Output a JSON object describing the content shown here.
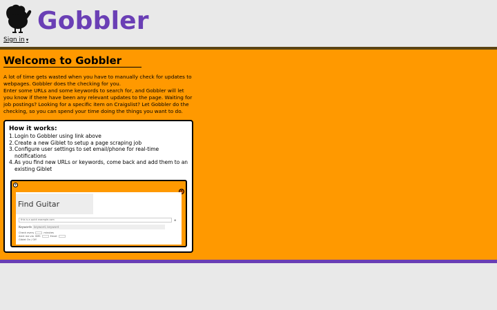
{
  "header": {
    "brand": "Gobbler",
    "signin_label": "Sign in",
    "signin_caret": "▾"
  },
  "main": {
    "welcome_title": "Welcome to Gobbler",
    "intro_lines": [
      "A lot of time gets wasted when you have to manually check for updates to",
      "webpages. Gobbler does the checking for you.",
      "Enter some URLs and some keywords to search for, and Gobbler will let",
      "you know if there have been any relevant updates to the page. Waiting for",
      "job postings? Looking for a specific item on Craigslist? Let Gobbler do the",
      "checking, so you can spend your time doing the things you want to do."
    ]
  },
  "how_it_works": {
    "title": "How it works:",
    "steps": [
      "Login to Gobbler using link above",
      "Create a new Giblet to setup a page scraping job",
      "Configure user settings to set email/phone for real-time notifications",
      "As you find new URLs or keywords, come back and add them to an existing Giblet"
    ]
  },
  "preview": {
    "plus_icon": "+",
    "close_icon": "×",
    "giblet_name": "Find Guitar",
    "url_value": "this is a quick example.com",
    "url_button": "⊕",
    "keywords_label": "Keywords",
    "keywords_value": "keyword, keyword",
    "check_every_label": "Check every",
    "check_every_unit": "minutes",
    "alert_label": "Alert me via",
    "alert_sms": "SMS",
    "alert_email": "Email",
    "giblet_toggle": "Giblet On / Off"
  },
  "colors": {
    "brand_purple": "#6a3fb5",
    "main_orange": "#ff9900",
    "top_band": "#5b4414",
    "page_bg": "#e9e9e9"
  },
  "icons": {
    "logo": "turkey-icon",
    "signin_dropdown": "caret-down-icon"
  }
}
